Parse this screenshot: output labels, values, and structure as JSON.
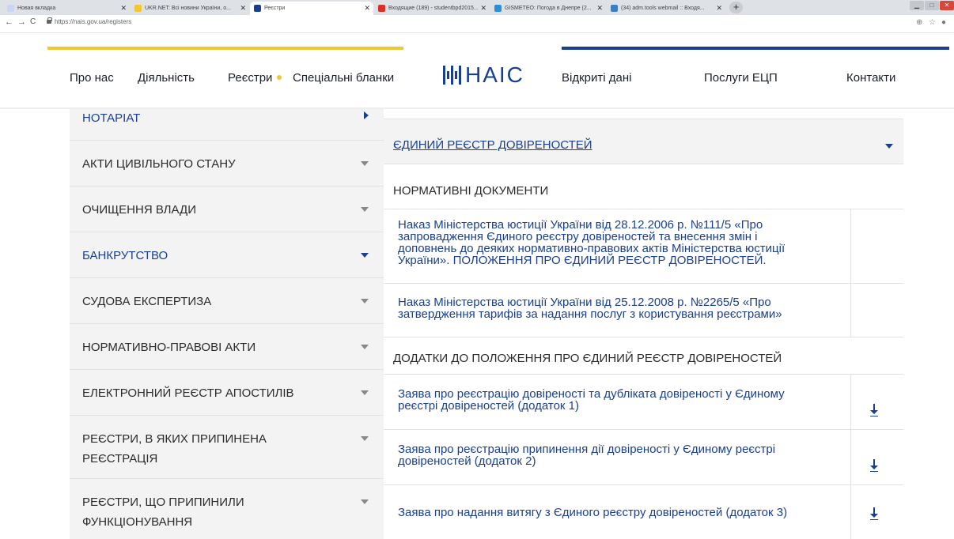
{
  "browser": {
    "tabs": [
      {
        "label": "Новая вкладка",
        "color": "#c8d6f5"
      },
      {
        "label": "UKR.NET: Всі новини України, о...",
        "color": "#f2c62e"
      },
      {
        "label": "Реєстри",
        "color": "#1a3f8f"
      },
      {
        "label": "Входящие (189) - studentbpd2015...",
        "color": "#d93025"
      },
      {
        "label": "GISMETEO: Погода в Днепре (2...",
        "color": "#2b8fd9"
      },
      {
        "label": "(34) adm.tools webmail :: Входя...",
        "color": "#3b7fc4"
      }
    ],
    "new_tab": "+",
    "url": "https://nais.gov.ua/registers",
    "back": "←",
    "forward": "→",
    "reload": "C",
    "zoom_icon": "zoom-icon",
    "star_icon": "star-icon",
    "account_icon": "account-icon",
    "window_min": "▁",
    "window_max": "□",
    "window_close": "✕"
  },
  "header": {
    "nav_left": [
      "Про нас",
      "Діяльність",
      "Реєстри",
      "Спеціальні бланки"
    ],
    "logo_text": "НАІС",
    "nav_right": [
      "Відкриті дані",
      "Послуги ЕЦП",
      "Контакти"
    ],
    "accent_yellow": "#f2c62e",
    "accent_blue": "#1a3f8f"
  },
  "sidebar": {
    "items": [
      {
        "label": "НОТАРІАТ",
        "active": true
      },
      {
        "label": "АКТИ ЦИВІЛЬНОГО СТАНУ"
      },
      {
        "label": "ОЧИЩЕННЯ ВЛАДИ"
      },
      {
        "label": "БАНКРУТСТВО",
        "active": true
      },
      {
        "label": "СУДОВА ЕКСПЕРТИЗА"
      },
      {
        "label": "НОРМАТИВНО-ПРАВОВІ АКТИ"
      },
      {
        "label": "ЕЛЕКТРОННИЙ РЕЄСТР АПОСТИЛІВ"
      },
      {
        "label_line1": "РЕЄСТРИ, В ЯКИХ ПРИПИНЕНА",
        "label_line2": "РЕЄСТРАЦІЯ"
      },
      {
        "label_line1": "РЕЄСТРИ, ЩО ПРИПИНИЛИ",
        "label_line2": "ФУНКЦІОНУВАННЯ"
      }
    ]
  },
  "main": {
    "heading": "ЄДИНИЙ РЕЄСТР ДОВІРЕНОСТЕЙ",
    "section1": "НОРМАТИВНІ ДОКУМЕНТИ",
    "docs": [
      {
        "line1": "Наказ Міністерства юстиції України від 28.12.2006 р. №111/5 «Про",
        "line2": "запровадження Єдиного реєстру довіреностей та внесення змін і",
        "line3": "доповнень до деяких нормативно-правових актів Міністерства юстиції",
        "line4": "України». ПОЛОЖЕННЯ ПРО ЄДИНИЙ РЕЄСТР ДОВІРЕНОСТЕЙ."
      },
      {
        "line1": "Наказ Міністерства юстиції України від 25.12.2008 р. №2265/5 «Про",
        "line2": "затвердження тарифів за надання послуг з користування реєстрами»"
      }
    ],
    "section2": "ДОДАТКИ ДО ПОЛОЖЕННЯ ПРО ЄДИНИЙ РЕЄСТР ДОВІРЕНОСТЕЙ",
    "attachments": [
      {
        "line1": "Заява про реєстрацію довіреності та дубліката довіреності у Єдиному",
        "line2": "реєстрі довіреностей (додаток 1)",
        "icon": "download-icon"
      },
      {
        "line1": "Заява про реєстрацію припинення дії довіреності у Єдиному реєстрі",
        "line2": "довіреностей (додаток 2)",
        "icon": "download-icon"
      },
      {
        "line1": "Заява про надання витягу з Єдиного реєстру довіреностей (додаток 3)",
        "icon": "download-icon"
      }
    ]
  }
}
